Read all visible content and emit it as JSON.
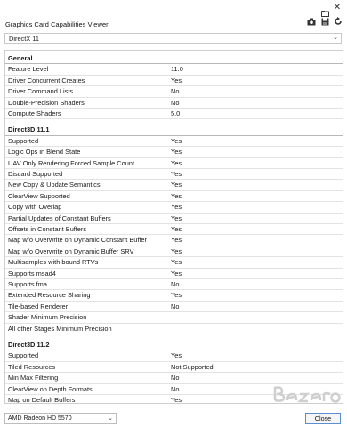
{
  "window": {
    "title": "Graphics Card Capabilities Viewer",
    "close_glyph": "✕"
  },
  "toolbar": {
    "icons": [
      "camera-icon",
      "save-icon",
      "refresh-icon",
      "open-icon"
    ]
  },
  "api_select": {
    "value": "DirectX 11"
  },
  "rows": [
    {
      "type": "section",
      "label": "General"
    },
    {
      "type": "item",
      "label": "Feature Level",
      "value": "11.0"
    },
    {
      "type": "item",
      "label": "Driver Concurrent Creates",
      "value": "Yes"
    },
    {
      "type": "item",
      "label": "Driver Command Lists",
      "value": "No"
    },
    {
      "type": "item",
      "label": "Double-Precision Shaders",
      "value": "No"
    },
    {
      "type": "item",
      "label": "Compute Shaders",
      "value": "5.0"
    },
    {
      "type": "section",
      "label": "Direct3D 11.1"
    },
    {
      "type": "item",
      "label": "Supported",
      "value": "Yes"
    },
    {
      "type": "item",
      "label": "Logic Ops in Blend State",
      "value": "Yes"
    },
    {
      "type": "item",
      "label": "UAV Only Rendering Forced Sample Count",
      "value": "Yes"
    },
    {
      "type": "item",
      "label": "Discard Supported",
      "value": "Yes"
    },
    {
      "type": "item",
      "label": "New Copy & Update Semantics",
      "value": "Yes"
    },
    {
      "type": "item",
      "label": "ClearView Supported",
      "value": "Yes"
    },
    {
      "type": "item",
      "label": "Copy with Overlap",
      "value": "Yes"
    },
    {
      "type": "item",
      "label": "Partial Updates of Constant Buffers",
      "value": "Yes"
    },
    {
      "type": "item",
      "label": "Offsets in Constant Buffers",
      "value": "Yes"
    },
    {
      "type": "item",
      "label": "Map w/o Overwrite on Dynamic Constant Buffer",
      "value": "Yes"
    },
    {
      "type": "item",
      "label": "Map w/o Overwrite on Dynamic Buffer SRV",
      "value": "Yes"
    },
    {
      "type": "item",
      "label": "Multisamples with bound RTVs",
      "value": "Yes"
    },
    {
      "type": "item",
      "label": "Supports msad4",
      "value": "Yes"
    },
    {
      "type": "item",
      "label": "Supports fma",
      "value": "No"
    },
    {
      "type": "item",
      "label": "Extended Resource Sharing",
      "value": "Yes"
    },
    {
      "type": "item",
      "label": "Tile-based Renderer",
      "value": "No"
    },
    {
      "type": "item",
      "label": "Shader Minimum Precision",
      "value": ""
    },
    {
      "type": "item",
      "label": "All other Stages Minimum Precision",
      "value": ""
    },
    {
      "type": "section",
      "label": "Direct3D 11.2"
    },
    {
      "type": "item",
      "label": "Supported",
      "value": "Yes"
    },
    {
      "type": "item",
      "label": "Tiled Resources",
      "value": "Not Supported"
    },
    {
      "type": "item",
      "label": "Min Max Filtering",
      "value": "No"
    },
    {
      "type": "item",
      "label": "ClearView on Depth Formats",
      "value": "No"
    },
    {
      "type": "item",
      "label": "Map on Default Buffers",
      "value": "Yes"
    }
  ],
  "gpu_select": {
    "value": "AMD Radeon HD 5570"
  },
  "close_button": {
    "label": "Close"
  },
  "watermark": {
    "text": "Bazar",
    "color": "#c8c8c8"
  }
}
